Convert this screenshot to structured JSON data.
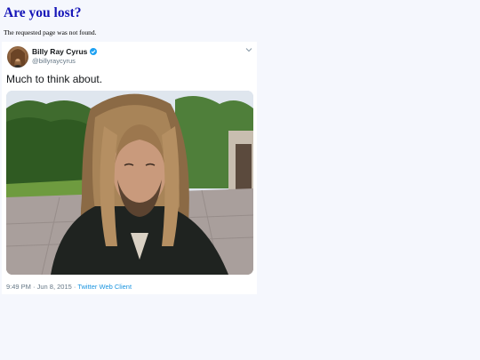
{
  "page": {
    "title": "Are you lost?",
    "message": "The requested page was not found."
  },
  "tweet": {
    "author_name": "Billy Ray Cyrus",
    "handle": "@billyraycyrus",
    "verified": true,
    "text": "Much to think about.",
    "timestamp": "9:49 PM · Jun 8, 2015",
    "separator": " · ",
    "client": "Twitter Web Client",
    "icons": {
      "verified": "verified-badge-icon",
      "menu": "chevron-down-icon"
    },
    "colors": {
      "verified": "#1da1f2",
      "link": "#1b95e0",
      "muted": "#657786"
    }
  }
}
